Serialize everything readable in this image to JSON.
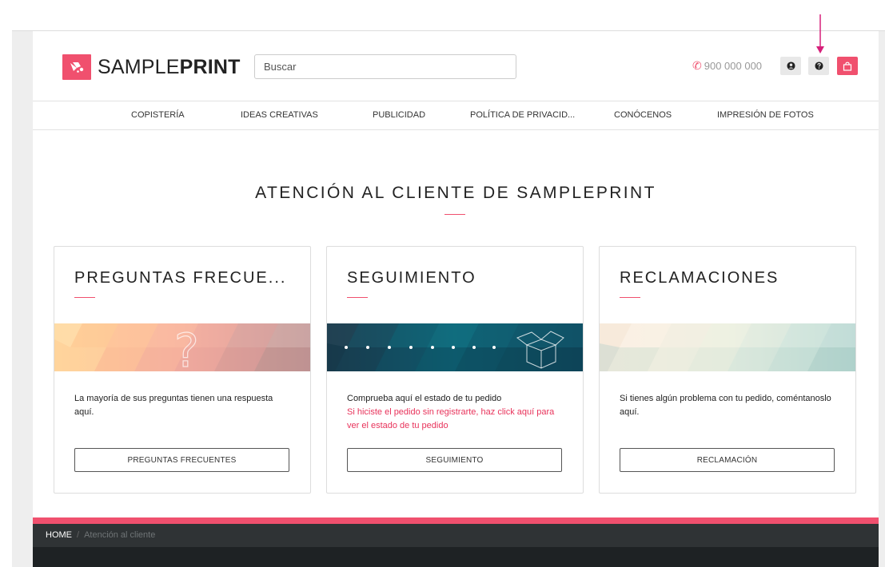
{
  "colors": {
    "accent": "#f0506e",
    "dark": "#1e2224",
    "breadcrumb_bg": "#2f3335"
  },
  "header": {
    "logo_word_light": "SAMPLE",
    "logo_word_bold": "PRINT",
    "search_placeholder": "Buscar",
    "phone": "900 000 000",
    "icons": [
      "user-icon",
      "help-icon",
      "shopping-bag-icon"
    ]
  },
  "nav": {
    "items": [
      {
        "label": "COPISTERÍA"
      },
      {
        "label": "IDEAS CREATIVAS"
      },
      {
        "label": "PUBLICIDAD"
      },
      {
        "label": "POLÍTICA DE PRIVACID..."
      },
      {
        "label": "CONÓCENOS"
      },
      {
        "label": "IMPRESIÓN DE FOTOS"
      }
    ]
  },
  "main": {
    "title": "ATENCIÓN AL CLIENTE DE SAMPLEPRINT",
    "cards": [
      {
        "title": "PREGUNTAS FRECUE...",
        "desc": "La mayoría de sus preguntas tienen una respuesta aquí.",
        "button": "PREGUNTAS FRECUENTES"
      },
      {
        "title": "SEGUIMIENTO",
        "desc": "Comprueba aquí el estado de tu pedido",
        "desc_line2": "Si hiciste el pedido sin registrarte, ",
        "link": "haz click aquí para ver el estado de tu pedido",
        "button": "SEGUIMIENTO"
      },
      {
        "title": "RECLAMACIONES",
        "desc": "Si tienes algún problema con tu pedido, coméntanoslo aquí.",
        "button": "RECLAMACIÓN"
      }
    ]
  },
  "breadcrumb": {
    "home": "HOME",
    "separator": "/",
    "current": "Atención al cliente"
  }
}
